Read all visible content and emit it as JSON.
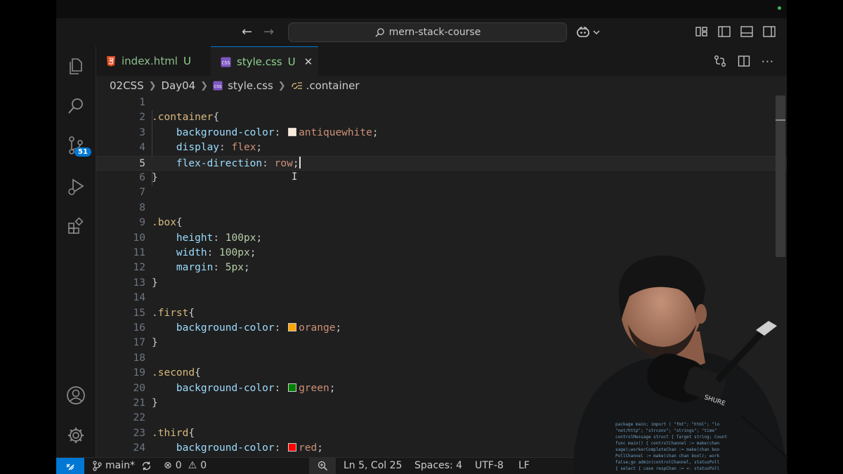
{
  "window": {
    "search_text": "mern-stack-course"
  },
  "tabs": [
    {
      "label": "index.html",
      "status": "U",
      "icon": "html5-icon"
    },
    {
      "label": "style.css",
      "status": "U",
      "icon": "css-icon",
      "active": true
    }
  ],
  "breadcrumb": {
    "items": [
      "02CSS",
      "Day04",
      "style.css",
      ".container"
    ]
  },
  "activity_bar": {
    "source_control_badge": "51",
    "icons": [
      "explorer-icon",
      "search-icon",
      "source-control-icon",
      "run-debug-icon",
      "extensions-icon",
      "account-icon",
      "settings-gear-icon"
    ]
  },
  "editor": {
    "current_line": 5,
    "lines": [
      {
        "n": "1",
        "tokens": []
      },
      {
        "n": "2",
        "tokens": [
          {
            "t": ".container",
            "c": "sel"
          },
          {
            "t": "{",
            "c": "punct"
          }
        ]
      },
      {
        "n": "3",
        "tokens": [
          {
            "t": "    "
          },
          {
            "t": "background-color",
            "c": "prop"
          },
          {
            "t": ": ",
            "c": "punct"
          },
          {
            "swatch": "#faebd7"
          },
          {
            "t": "antiquewhite",
            "c": "val"
          },
          {
            "t": ";",
            "c": "punct"
          }
        ]
      },
      {
        "n": "4",
        "tokens": [
          {
            "t": "    "
          },
          {
            "t": "display",
            "c": "prop"
          },
          {
            "t": ": ",
            "c": "punct"
          },
          {
            "t": "flex",
            "c": "val"
          },
          {
            "t": ";",
            "c": "punct"
          }
        ]
      },
      {
        "n": "5",
        "tokens": [
          {
            "t": "    "
          },
          {
            "t": "flex-direction",
            "c": "prop"
          },
          {
            "t": ": ",
            "c": "punct"
          },
          {
            "t": "row",
            "c": "val"
          },
          {
            "t": ";",
            "c": "punct"
          },
          {
            "caret": true
          }
        ]
      },
      {
        "n": "6",
        "tokens": [
          {
            "t": "}",
            "c": "punct"
          }
        ]
      },
      {
        "n": "7",
        "tokens": []
      },
      {
        "n": "8",
        "tokens": []
      },
      {
        "n": "9",
        "tokens": [
          {
            "t": ".box",
            "c": "sel"
          },
          {
            "t": "{",
            "c": "punct"
          }
        ]
      },
      {
        "n": "10",
        "tokens": [
          {
            "t": "    "
          },
          {
            "t": "height",
            "c": "prop"
          },
          {
            "t": ": ",
            "c": "punct"
          },
          {
            "t": "100px",
            "c": "num"
          },
          {
            "t": ";",
            "c": "punct"
          }
        ]
      },
      {
        "n": "11",
        "tokens": [
          {
            "t": "    "
          },
          {
            "t": "width",
            "c": "prop"
          },
          {
            "t": ": ",
            "c": "punct"
          },
          {
            "t": "100px",
            "c": "num"
          },
          {
            "t": ";",
            "c": "punct"
          }
        ]
      },
      {
        "n": "12",
        "tokens": [
          {
            "t": "    "
          },
          {
            "t": "margin",
            "c": "prop"
          },
          {
            "t": ": ",
            "c": "punct"
          },
          {
            "t": "5px",
            "c": "num"
          },
          {
            "t": ";",
            "c": "punct"
          }
        ]
      },
      {
        "n": "13",
        "tokens": [
          {
            "t": "}",
            "c": "punct"
          }
        ]
      },
      {
        "n": "14",
        "tokens": []
      },
      {
        "n": "15",
        "tokens": [
          {
            "t": ".first",
            "c": "sel"
          },
          {
            "t": "{",
            "c": "punct"
          }
        ]
      },
      {
        "n": "16",
        "tokens": [
          {
            "t": "    "
          },
          {
            "t": "background-color",
            "c": "prop"
          },
          {
            "t": ": ",
            "c": "punct"
          },
          {
            "swatch": "#ffa500"
          },
          {
            "t": "orange",
            "c": "val"
          },
          {
            "t": ";",
            "c": "punct"
          }
        ]
      },
      {
        "n": "17",
        "tokens": [
          {
            "t": "}",
            "c": "punct"
          }
        ]
      },
      {
        "n": "18",
        "tokens": []
      },
      {
        "n": "19",
        "tokens": [
          {
            "t": ".second",
            "c": "sel"
          },
          {
            "t": "{",
            "c": "punct"
          }
        ]
      },
      {
        "n": "20",
        "tokens": [
          {
            "t": "    "
          },
          {
            "t": "background-color",
            "c": "prop"
          },
          {
            "t": ": ",
            "c": "punct"
          },
          {
            "swatch": "#008000"
          },
          {
            "t": "green",
            "c": "val"
          },
          {
            "t": ";",
            "c": "punct"
          }
        ]
      },
      {
        "n": "21",
        "tokens": [
          {
            "t": "}",
            "c": "punct"
          }
        ]
      },
      {
        "n": "22",
        "tokens": []
      },
      {
        "n": "23",
        "tokens": [
          {
            "t": ".third",
            "c": "sel"
          },
          {
            "t": "{",
            "c": "punct"
          }
        ]
      },
      {
        "n": "24",
        "tokens": [
          {
            "t": "    "
          },
          {
            "t": "background-color",
            "c": "prop"
          },
          {
            "t": ": ",
            "c": "punct"
          },
          {
            "swatch": "#ff0000"
          },
          {
            "t": "red",
            "c": "val"
          },
          {
            "t": ";",
            "c": "punct"
          }
        ]
      }
    ]
  },
  "status_bar": {
    "branch": "main*",
    "errors": "0",
    "warnings": "0",
    "position": "Ln 5, Col 25",
    "spaces": "Spaces: 4",
    "encoding": "UTF-8",
    "eol": "LF"
  },
  "colors": {
    "accent": "#0078d4",
    "editor_bg": "#1f1f1f",
    "chrome_bg": "#181818",
    "modified_green": "#8fd18f"
  }
}
